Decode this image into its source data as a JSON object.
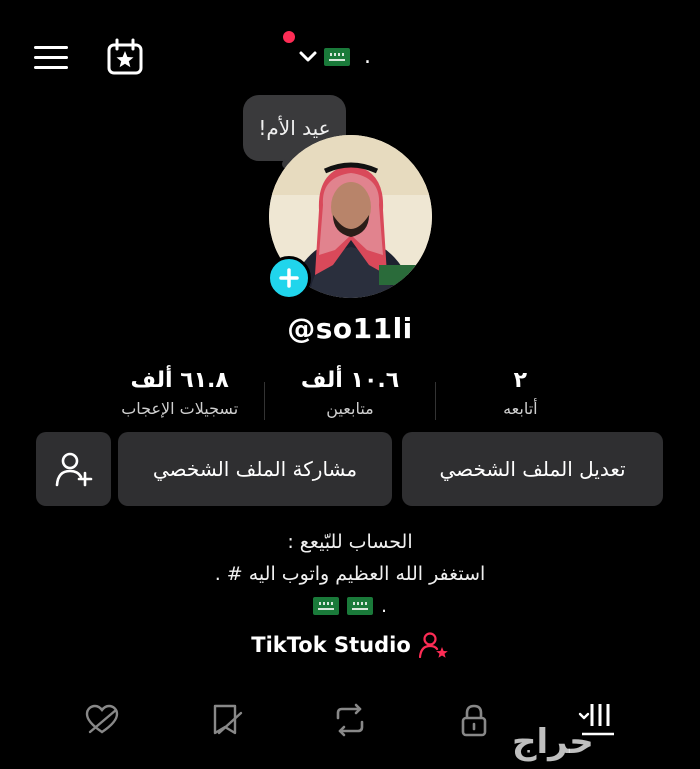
{
  "header": {
    "menu_icon": "hamburger-menu-icon",
    "calendar_icon": "calendar-star-icon",
    "account_suffix": "."
  },
  "speech_bubble": {
    "text": "عيد الأم!"
  },
  "profile": {
    "username": "@so11li",
    "stats": [
      {
        "value": "٦١.٨ ألف",
        "label": "تسجيلات الإعجاب"
      },
      {
        "value": "١٠.٦ ألف",
        "label": "متابعين"
      },
      {
        "value": "٢",
        "label": "أتابعه"
      }
    ]
  },
  "buttons": {
    "edit_profile": "تعديل الملف الشخصي",
    "share_profile": "مشاركة الملف الشخصي"
  },
  "bio": {
    "line1": "الحساب للبّيعع :",
    "line2": "استغفر الله العظيم واتوب اليه # .",
    "line3": "."
  },
  "studio": {
    "label": "TikTok Studio"
  },
  "watermark": {
    "text": "حراج"
  },
  "colors": {
    "accent_cyan": "#20d5ec",
    "accent_red": "#fe2c55",
    "button_bg": "#2f2f31"
  }
}
